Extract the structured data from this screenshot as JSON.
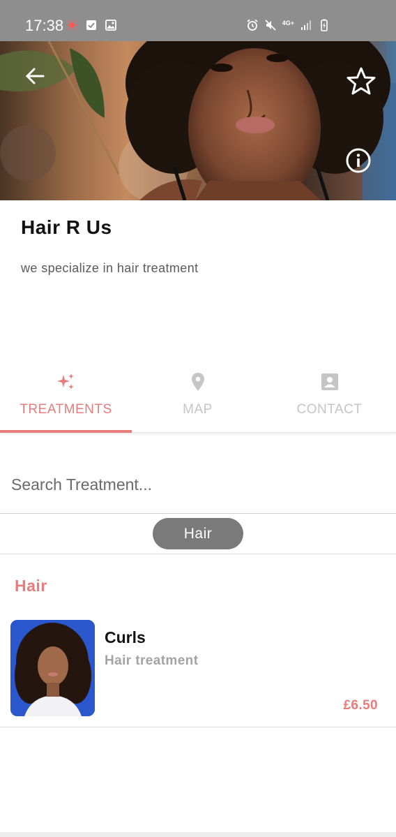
{
  "status_bar": {
    "time": "17:38",
    "network": "4G+",
    "left_icons": [
      "cast-icon",
      "check-icon",
      "image-icon"
    ],
    "right_icons": [
      "alarm-icon",
      "mute-icon",
      "network-icon",
      "signal-icon",
      "battery-charging-icon"
    ]
  },
  "hero": {
    "back_icon": "arrow-left-icon",
    "favorite_icon": "star-outline-icon",
    "info_icon": "info-icon"
  },
  "business": {
    "name": "Hair R Us",
    "description": "we specialize in hair treatment"
  },
  "tabs": [
    {
      "label": "TREATMENTS",
      "icon": "sparkles-icon",
      "active": true
    },
    {
      "label": "MAP",
      "icon": "map-pin-icon",
      "active": false
    },
    {
      "label": "CONTACT",
      "icon": "contact-card-icon",
      "active": false
    }
  ],
  "search": {
    "placeholder": "Search Treatment..."
  },
  "chips": [
    {
      "label": "Hair",
      "selected": true
    }
  ],
  "sections": [
    {
      "title": "Hair",
      "items": [
        {
          "name": "Curls",
          "description": "Hair treatment",
          "price": "£6.50"
        }
      ]
    }
  ],
  "colors": {
    "accent": "#e77c7b",
    "status_bar": "#8e8e8e",
    "chip_bg": "#7a7a7a",
    "inactive_tab": "#c5c5c5"
  }
}
